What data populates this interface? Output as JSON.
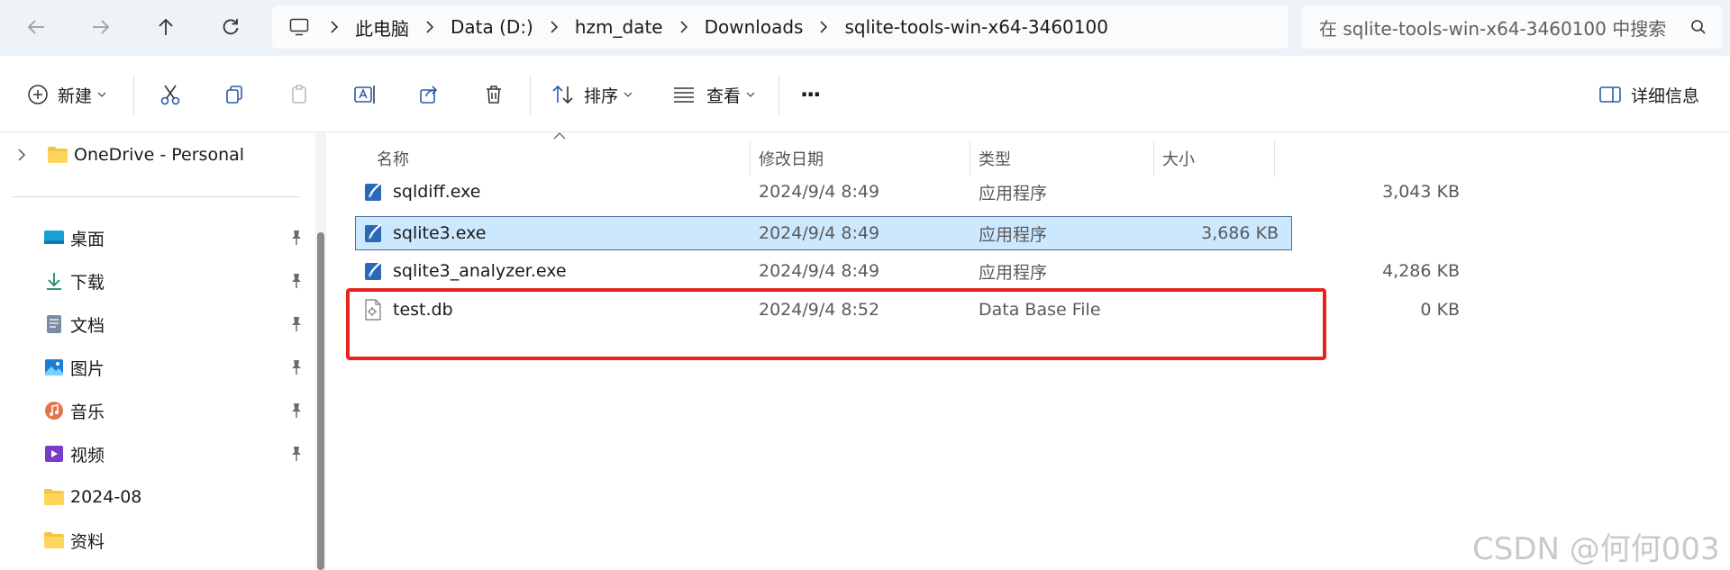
{
  "nav": {
    "back_icon": "arrow-left-icon",
    "forward_icon": "arrow-right-icon",
    "up_icon": "arrow-up-icon",
    "refresh_icon": "refresh-icon"
  },
  "breadcrumb": {
    "items": [
      "此电脑",
      "Data (D:)",
      "hzm_date",
      "Downloads",
      "sqlite-tools-win-x64-3460100"
    ]
  },
  "search": {
    "placeholder": "在 sqlite-tools-win-x64-3460100 中搜索"
  },
  "toolbar": {
    "new_label": "新建",
    "sort_label": "排序",
    "view_label": "查看",
    "more_label": "···",
    "details_label": "详细信息"
  },
  "sidebar": {
    "onedrive": "OneDrive - Personal",
    "items": [
      {
        "label": "桌面",
        "icon": "desktop-icon",
        "pinned": true
      },
      {
        "label": "下载",
        "icon": "download-icon",
        "pinned": true
      },
      {
        "label": "文档",
        "icon": "document-icon",
        "pinned": true
      },
      {
        "label": "图片",
        "icon": "picture-icon",
        "pinned": true
      },
      {
        "label": "音乐",
        "icon": "music-icon",
        "pinned": true
      },
      {
        "label": "视频",
        "icon": "video-icon",
        "pinned": true
      },
      {
        "label": "2024-08",
        "icon": "folder-icon",
        "pinned": false
      },
      {
        "label": "资料",
        "icon": "folder-icon",
        "pinned": false
      }
    ]
  },
  "columns": {
    "name": "名称",
    "date": "修改日期",
    "type": "类型",
    "size": "大小"
  },
  "files": [
    {
      "name": "sqldiff.exe",
      "date": "2024/9/4 8:49",
      "type": "应用程序",
      "size": "3,043 KB"
    },
    {
      "name": "sqlite3.exe",
      "date": "2024/9/4 8:49",
      "type": "应用程序",
      "size": "3,686 KB"
    },
    {
      "name": "sqlite3_analyzer.exe",
      "date": "2024/9/4 8:49",
      "type": "应用程序",
      "size": "4,286 KB"
    },
    {
      "name": "test.db",
      "date": "2024/9/4 8:52",
      "type": "Data Base File",
      "size": "0 KB"
    }
  ],
  "watermark": "CSDN @何何003",
  "colors": {
    "selection": "#cce8ff",
    "highlight_box": "#e8231f",
    "address_bar_bg": "#eef3f8"
  }
}
